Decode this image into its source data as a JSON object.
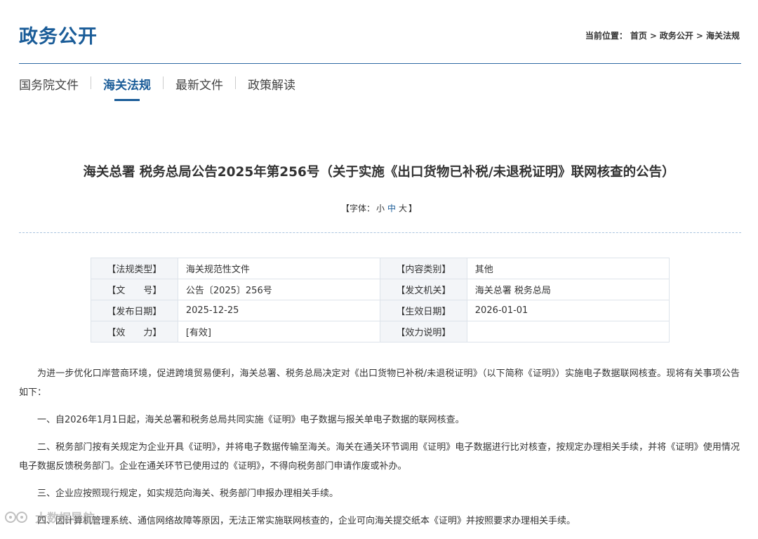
{
  "header": {
    "title": "政务公开",
    "breadcrumb": {
      "prefix": "当前位置：",
      "items": [
        "首页",
        "政务公开",
        "海关法规"
      ],
      "separator": ">"
    }
  },
  "nav": {
    "tabs": [
      {
        "label": "国务院文件",
        "active": false
      },
      {
        "label": "海关法规",
        "active": true
      },
      {
        "label": "最新文件",
        "active": false
      },
      {
        "label": "政策解读",
        "active": false
      }
    ]
  },
  "article": {
    "title": "海关总署 税务总局公告2025年第256号（关于实施《出口货物已补税/未退税证明》联网核查的公告）",
    "font_size": {
      "open": "【字体：",
      "small": "小",
      "medium": "中",
      "large": "大",
      "close": "】"
    },
    "meta": [
      [
        {
          "label": "【法规类型】",
          "value": "海关规范性文件"
        },
        {
          "label": "【内容类别】",
          "value": "其他"
        }
      ],
      [
        {
          "label": "【文　　号】",
          "value": "公告〔2025〕256号"
        },
        {
          "label": "【发文机关】",
          "value": "海关总署 税务总局"
        }
      ],
      [
        {
          "label": "【发布日期】",
          "value": "2025-12-25"
        },
        {
          "label": "【生效日期】",
          "value": "2026-01-01"
        }
      ],
      [
        {
          "label": "【效　　力】",
          "value": "[有效]"
        },
        {
          "label": "【效力说明】",
          "value": ""
        }
      ]
    ],
    "paragraphs": [
      "为进一步优化口岸营商环境，促进跨境贸易便利，海关总署、税务总局决定对《出口货物已补税/未退税证明》（以下简称《证明》）实施电子数据联网核查。现将有关事项公告如下：",
      "一、自2026年1月1日起，海关总署和税务总局共同实施《证明》电子数据与报关单电子数据的联网核查。",
      "二、税务部门按有关规定为企业开具《证明》，并将电子数据传输至海关。海关在通关环节调用《证明》电子数据进行比对核查，按规定办理相关手续，并将《证明》使用情况电子数据反馈税务部门。企业在通关环节已使用过的《证明》，不得向税务部门申请作废或补办。",
      "三、企业应按照现行规定，如实规范向海关、税务部门申报办理相关手续。",
      "四、因计算机管理系统、通信网络故障等原因，无法正常实施联网核查的，企业可向海关提交纸本《证明》并按照要求办理相关手续。"
    ]
  },
  "watermark": {
    "text": "大数据导航"
  },
  "colors": {
    "accent": "#1a5c98",
    "divider": "#2f6aa3",
    "table_border": "#dde3ea",
    "label_bg": "#f3f5f8"
  }
}
